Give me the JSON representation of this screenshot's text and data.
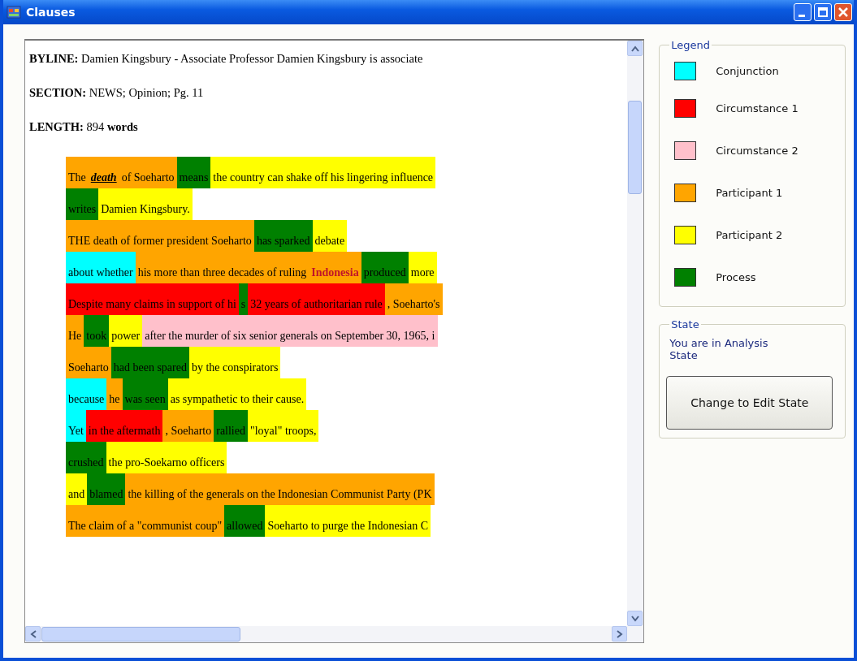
{
  "window": {
    "title": "Clauses"
  },
  "document": {
    "header": [
      "**BYLINE:** Damien Kingsbury - Associate Professor Damien Kingsbury is associate",
      "**SECTION:** NEWS; Opinion; Pg. 11",
      "**LENGTH:** 894 **words**"
    ],
    "lines": [
      [
        {
          "text": "The ",
          "color": "#ffa500"
        },
        {
          "text": "death",
          "color": "#ffa500",
          "kind": "emphasis"
        },
        {
          "text": " of Soeharto",
          "color": "#ffa500"
        },
        {
          "text": "means",
          "color": "#008000"
        },
        {
          "text": "the country can shake off his lingering influence",
          "color": "#ffff00"
        }
      ],
      [
        {
          "text": "writes",
          "color": "#008000"
        },
        {
          "text": "Damien Kingsbury.",
          "color": "#ffff00"
        }
      ],
      [
        {
          "text": "THE death of former president Soeharto",
          "color": "#ffa500"
        },
        {
          "text": "has sparked",
          "color": "#008000"
        },
        {
          "text": "debate",
          "color": "#ffff00"
        }
      ],
      [
        {
          "text": "about whether",
          "color": "#00ffff"
        },
        {
          "text": "his more than three decades of ruling ",
          "color": "#ffa500"
        },
        {
          "text": "Indonesia",
          "color": "#ffa500",
          "kind": "name"
        },
        {
          "text": "produced",
          "color": "#008000"
        },
        {
          "text": "more",
          "color": "#ffff00"
        }
      ],
      [
        {
          "text": "Despite many claims in support of hi",
          "color": "#ff0000"
        },
        {
          "text": "s",
          "color": "#008000"
        },
        {
          "text": "32 years of authoritarian rule",
          "color": "#ff0000"
        },
        {
          "text": ", Soeharto's",
          "color": "#ffa500"
        }
      ],
      [
        {
          "text": "He",
          "color": "#ffa500"
        },
        {
          "text": "took",
          "color": "#008000"
        },
        {
          "text": "power",
          "color": "#ffff00"
        },
        {
          "text": "after the murder of six senior generals on September 30, 1965, i",
          "color": "#ffc0cb"
        }
      ],
      [
        {
          "text": "Soeharto",
          "color": "#ffa500"
        },
        {
          "text": "had been spared",
          "color": "#008000"
        },
        {
          "text": "by the conspirators",
          "color": "#ffff00"
        }
      ],
      [
        {
          "text": "because",
          "color": "#00ffff"
        },
        {
          "text": "he",
          "color": "#ffa500"
        },
        {
          "text": "was seen",
          "color": "#008000"
        },
        {
          "text": "as sympathetic to their cause.",
          "color": "#ffff00"
        }
      ],
      [
        {
          "text": "Yet",
          "color": "#00ffff"
        },
        {
          "text": "in the aftermath",
          "color": "#ff0000"
        },
        {
          "text": ", Soeharto",
          "color": "#ffa500"
        },
        {
          "text": "rallied",
          "color": "#008000"
        },
        {
          "text": "\"loyal\" troops,",
          "color": "#ffff00"
        }
      ],
      [
        {
          "text": "crushed",
          "color": "#008000"
        },
        {
          "text": "the pro-Soekarno officers",
          "color": "#ffff00"
        }
      ],
      [
        {
          "text": "and",
          "color": "#ffff00"
        },
        {
          "text": "blamed",
          "color": "#008000"
        },
        {
          "text": "the killing of the generals on the Indonesian Communist Party (PK",
          "color": "#ffa500"
        }
      ],
      [
        {
          "text": "The claim of a \"communist coup\" ",
          "color": "#ffa500"
        },
        {
          "text": "allowed",
          "color": "#008000"
        },
        {
          "text": "Soeharto to purge the Indonesian C",
          "color": "#ffff00"
        }
      ]
    ]
  },
  "legend": {
    "title": "Legend",
    "items": [
      {
        "label": "Conjunction",
        "color": "#00ffff"
      },
      {
        "label": "Circumstance 1",
        "color": "#ff0000"
      },
      {
        "label": "Circumstance 2",
        "color": "#ffc0cb"
      },
      {
        "label": "Participant 1",
        "color": "#ffa500"
      },
      {
        "label": "Participant 2",
        "color": "#ffff00"
      },
      {
        "label": "Process",
        "color": "#008000"
      }
    ]
  },
  "state": {
    "title": "State",
    "message": "You are in Analysis State",
    "button": "Change to Edit State"
  }
}
